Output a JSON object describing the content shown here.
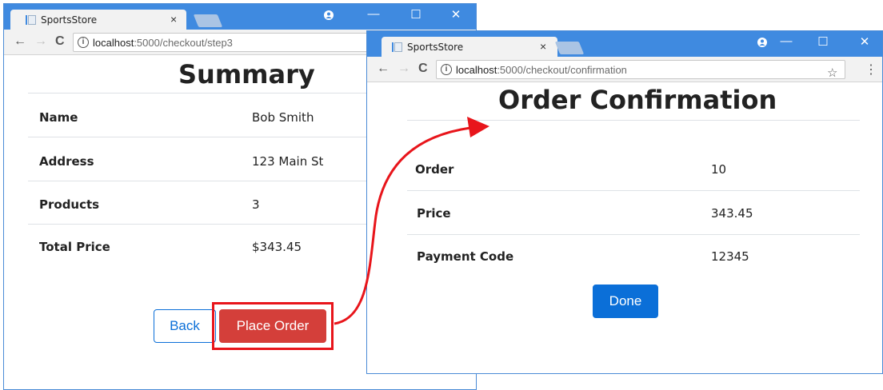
{
  "window_back": {
    "tab_title": "SportsStore",
    "url_host": "localhost",
    "url_path": ":5000/checkout/step3",
    "heading": "Summary",
    "rows": [
      {
        "label": "Name",
        "value": "Bob Smith"
      },
      {
        "label": "Address",
        "value": "123 Main St"
      },
      {
        "label": "Products",
        "value": "3"
      },
      {
        "label": "Total Price",
        "value": "$343.45"
      }
    ],
    "back_label": "Back",
    "place_order_label": "Place Order"
  },
  "window_front": {
    "tab_title": "SportsStore",
    "url_host": "localhost",
    "url_path": ":5000/checkout/confirmation",
    "heading": "Order Confirmation",
    "rows": [
      {
        "label": "Order",
        "value": "10"
      },
      {
        "label": "Price",
        "value": "343.45"
      },
      {
        "label": "Payment Code",
        "value": "12345"
      }
    ],
    "done_label": "Done"
  },
  "glyphs": {
    "close": "×",
    "minimize": "—",
    "maximize": "☐",
    "window_close": "✕",
    "back": "←",
    "forward": "→",
    "reload": "C",
    "info": "i",
    "star": "☆",
    "menu": "⋮"
  },
  "colors": {
    "titlebar": "#3f8ae0",
    "primary": "#0b6fd8",
    "danger": "#d43f3a",
    "highlight": "#e8151b"
  }
}
